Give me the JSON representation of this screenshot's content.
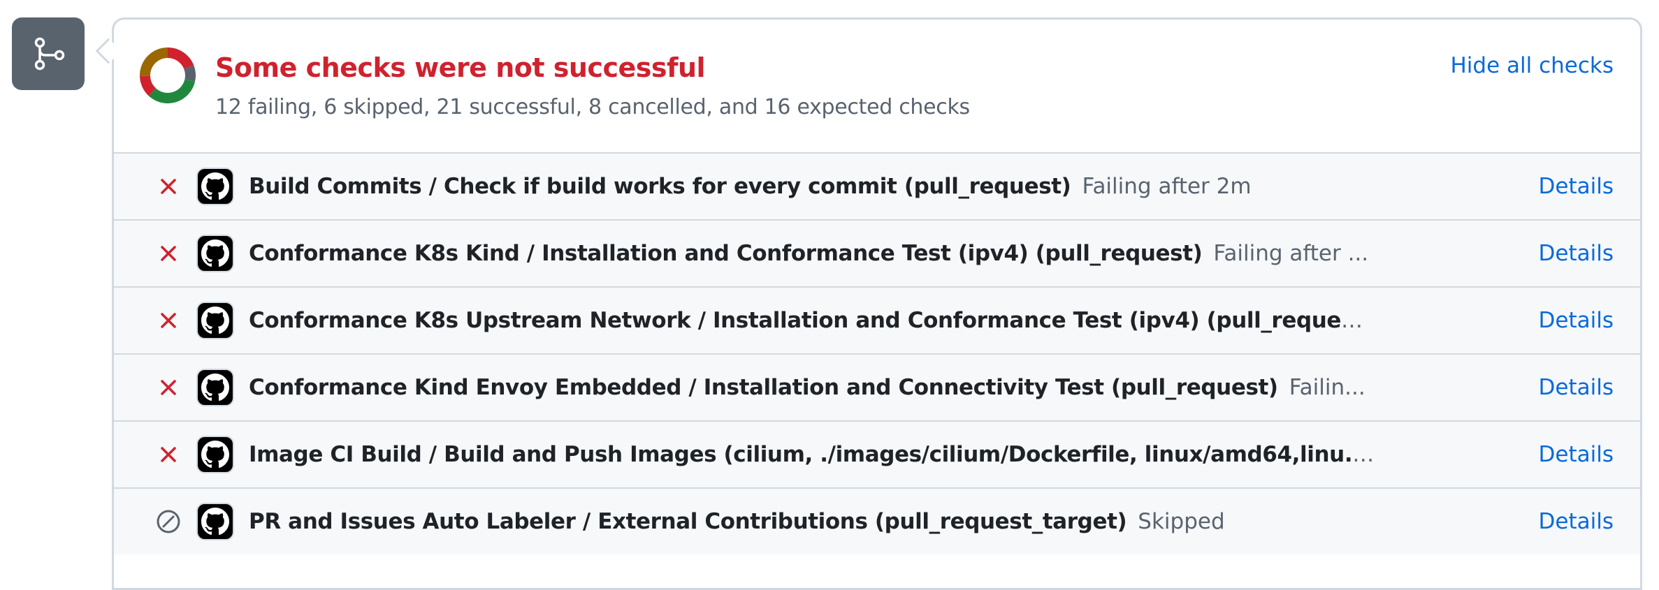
{
  "badge": {
    "icon": "git-merge-icon"
  },
  "header": {
    "title": "Some checks were not successful",
    "summary": "12 failing, 6 skipped, 21 successful, 8 cancelled, and 16 expected checks",
    "hide_label": "Hide all checks"
  },
  "colors": {
    "failing": "#cf222e",
    "skipped": "#59636e",
    "successful": "#1f883d",
    "cancelled": "#cf222e",
    "expected": "#9a6700",
    "link": "#0969da"
  },
  "donut": {
    "segments": [
      {
        "name": "failing",
        "count": 12,
        "color": "#cf222e"
      },
      {
        "name": "skipped",
        "count": 6,
        "color": "#59636e"
      },
      {
        "name": "successful",
        "count": 21,
        "color": "#1f883d"
      },
      {
        "name": "cancelled",
        "count": 8,
        "color": "#cf222e"
      },
      {
        "name": "expected",
        "count": 16,
        "color": "#9a6700"
      }
    ]
  },
  "checks": [
    {
      "status": "failing",
      "status_icon": "x-icon",
      "app_icon": "github-icon",
      "name": "Build Commits / Check if build works for every commit (pull_request)",
      "status_text": "Failing after 2m",
      "details_label": "Details"
    },
    {
      "status": "failing",
      "status_icon": "x-icon",
      "app_icon": "github-icon",
      "name": "Conformance K8s Kind / Installation and Conformance Test (ipv4) (pull_request)",
      "status_text": "Failing after ...",
      "details_label": "Details"
    },
    {
      "status": "failing",
      "status_icon": "x-icon",
      "app_icon": "github-icon",
      "name": "Conformance K8s Upstream Network / Installation and Conformance Test (ipv4) (pull_reques...",
      "status_text": "",
      "details_label": "Details"
    },
    {
      "status": "failing",
      "status_icon": "x-icon",
      "app_icon": "github-icon",
      "name": "Conformance Kind Envoy Embedded / Installation and Connectivity Test (pull_request)",
      "status_text": "Failin...",
      "details_label": "Details"
    },
    {
      "status": "failing",
      "status_icon": "x-icon",
      "app_icon": "github-icon",
      "name": "Image CI Build / Build and Push Images (cilium, ./images/cilium/Dockerfile, linux/amd64,linu...",
      "status_text": "",
      "details_label": "Details"
    },
    {
      "status": "skipped",
      "status_icon": "skip-icon",
      "app_icon": "github-icon",
      "name": "PR and Issues Auto Labeler / External Contributions (pull_request_target)",
      "status_text": "Skipped",
      "details_label": "Details"
    }
  ]
}
